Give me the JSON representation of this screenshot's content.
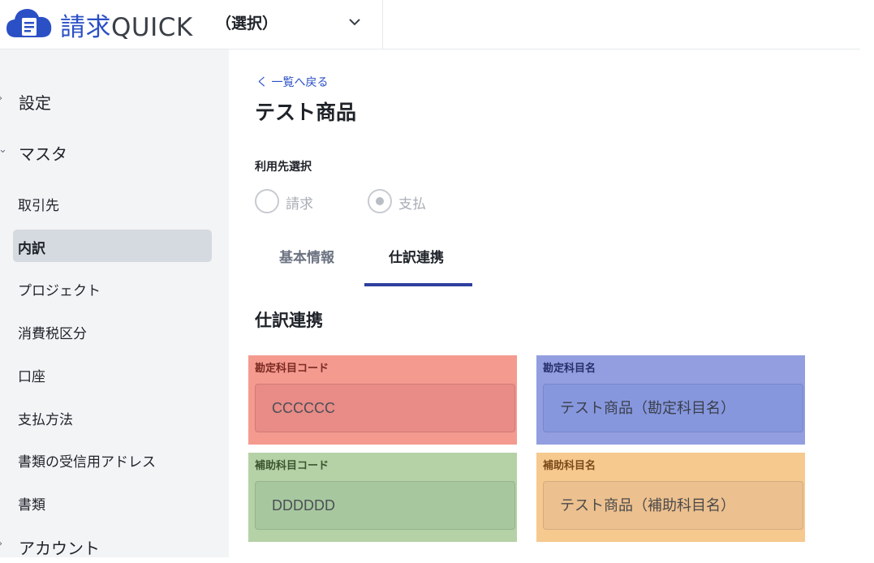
{
  "header": {
    "brand_main": "請求",
    "brand_sub": "QUICK",
    "selector_label": "（選択）"
  },
  "sidebar": {
    "groups": {
      "settings": "設定",
      "master": "マスタ",
      "account": "アカウント"
    },
    "items": [
      {
        "label": "取引先"
      },
      {
        "label": "内訳",
        "active": true
      },
      {
        "label": "プロジェクト"
      },
      {
        "label": "消費税区分"
      },
      {
        "label": "口座"
      },
      {
        "label": "支払方法"
      },
      {
        "label": "書類の受信用アドレス"
      },
      {
        "label": "書類"
      }
    ]
  },
  "main": {
    "back_link": "く 一覧へ戻る",
    "title": "テスト商品",
    "usage_label": "利用先選択",
    "radios": [
      {
        "label": "請求",
        "selected": false
      },
      {
        "label": "支払",
        "selected": true
      }
    ],
    "tabs": [
      {
        "label": "基本情報",
        "active": false
      },
      {
        "label": "仕訳連携",
        "active": true
      }
    ],
    "section_title": "仕訳連携",
    "fields": {
      "account_code": {
        "label": "勘定科目コード",
        "value": "CCCCCC"
      },
      "account_name": {
        "label": "勘定科目名",
        "value": "テスト商品（勘定科目名）"
      },
      "sub_account_code": {
        "label": "補助科目コード",
        "value": "DDDDDD"
      },
      "sub_account_name": {
        "label": "補助科目名",
        "value": "テスト商品（補助科目名）"
      }
    }
  },
  "colors": {
    "brand": "#2b50c5",
    "tab_underline": "#2e3f9e",
    "account_code_bg": "#f49a8f",
    "account_name_bg": "#939ee0",
    "sub_account_code_bg": "#b5d2a6",
    "sub_account_name_bg": "#f6c98f"
  }
}
